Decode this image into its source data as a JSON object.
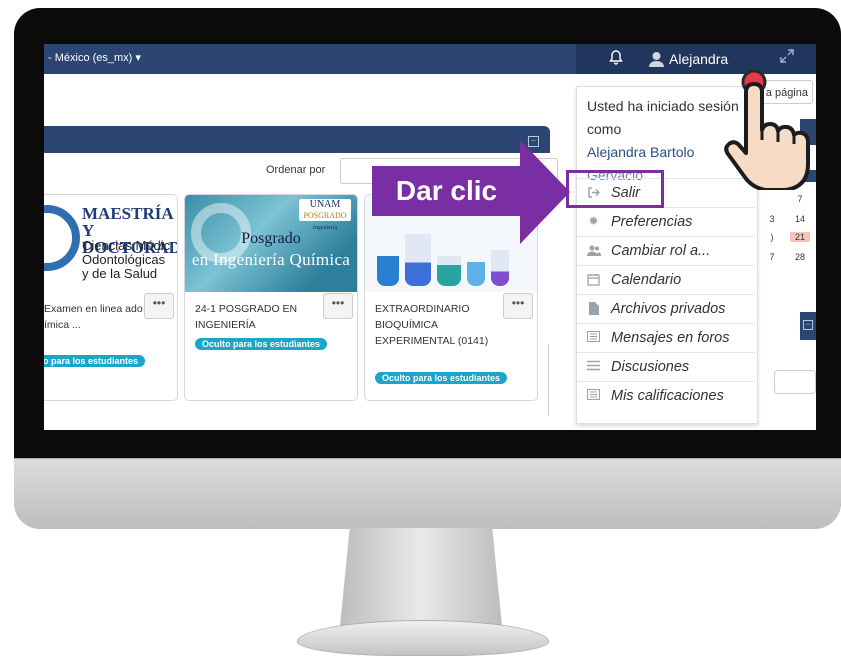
{
  "navbar": {
    "lang": "- México (es_mx) ▾",
    "user": "Alejandra"
  },
  "page_button": "a página",
  "sort_label": "Ordenar por",
  "courses": [
    {
      "image_lines": [
        "MAESTRÍA Y",
        "DOCTORAD",
        "Ciencias Médic",
        "Odontológicas",
        "y de la Salud"
      ],
      "title": "Examen en linea ado en ímica ...",
      "badge": "o para los estudiantes"
    },
    {
      "image_lines": [
        "UNAM",
        "POSGRADO",
        "Ingeniería",
        "Posgrado",
        "en Ingeniería Química"
      ],
      "title": "24-1 POSGRADO EN INGENIERÍA",
      "badge": "Oculto para los estudiantes"
    },
    {
      "title": "EXTRAORDINARIO BIOQUÍMICA EXPERIMENTAL (0141)",
      "badge": "Oculto para los estudiantes"
    }
  ],
  "more_label": "•••",
  "calendar": {
    "cells": [
      "7",
      "14",
      "21",
      "28"
    ],
    "partial": [
      "3",
      ")",
      "7"
    ]
  },
  "dropdown": {
    "intro_prefix": "Usted ha iniciado sesión como",
    "user_full": "Alejandra Bartolo",
    "user_cut": "Gervacio",
    "items": [
      {
        "icon": "logout-icon",
        "label": "Salir"
      },
      {
        "icon": "gear-icon",
        "label": "Preferencias"
      },
      {
        "icon": "users-icon",
        "label": "Cambiar rol a..."
      },
      {
        "icon": "calendar-icon",
        "label": "Calendario"
      },
      {
        "icon": "file-icon",
        "label": "Archivos privados"
      },
      {
        "icon": "message-icon",
        "label": "Mensajes en foros"
      },
      {
        "icon": "list-icon",
        "label": "Discusiones"
      },
      {
        "icon": "grades-icon",
        "label": "Mis calificaciones"
      }
    ]
  },
  "callout": "Dar clic",
  "colors": {
    "navbar": "#2b4673",
    "accent": "#7a2ea4",
    "badge": "#1aa6c9"
  }
}
